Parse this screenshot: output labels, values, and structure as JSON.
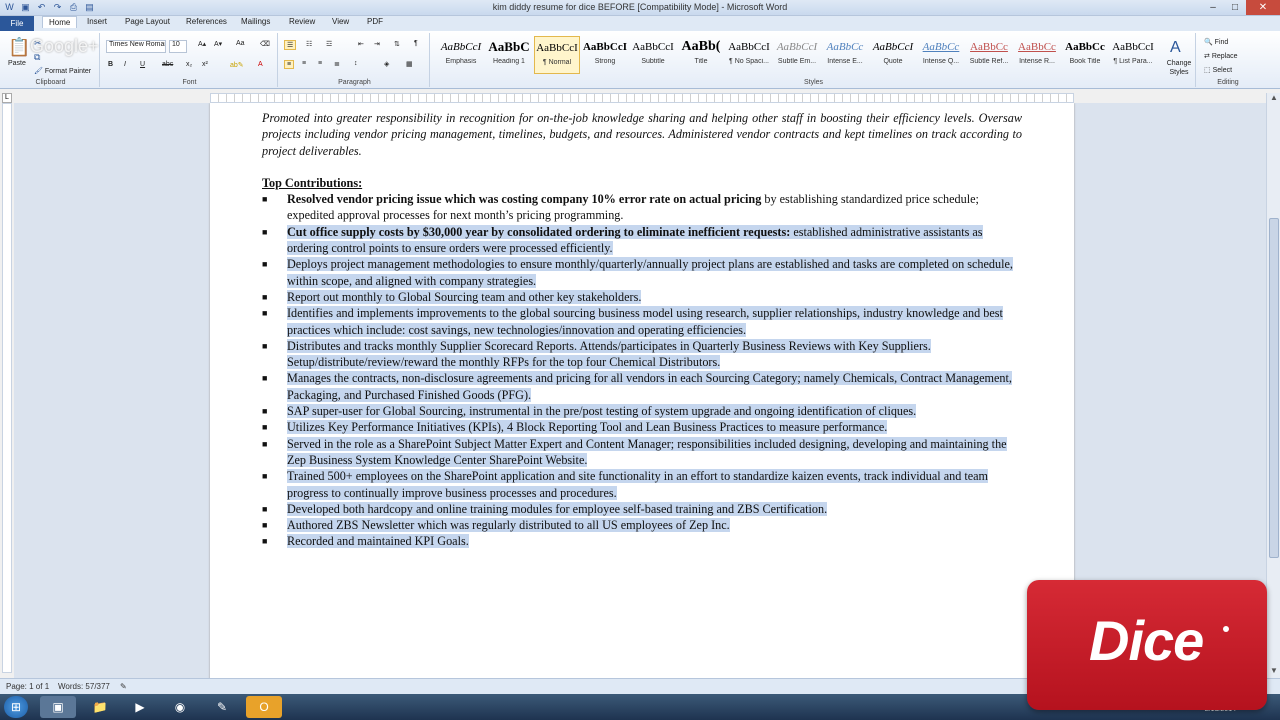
{
  "window": {
    "title": "kim diddy resume for dice  BEFORE [Compatibility Mode] - Microsoft Word"
  },
  "tabs": [
    "File",
    "Home",
    "Insert",
    "Page Layout",
    "References",
    "Mailings",
    "Review",
    "View",
    "PDF"
  ],
  "ribbon": {
    "clipboard": {
      "paste": "Paste",
      "format_painter": "Format Painter",
      "label": "Clipboard"
    },
    "font": {
      "name": "Times New Roman",
      "size": "10",
      "label": "Font"
    },
    "paragraph": {
      "label": "Paragraph"
    },
    "styles": {
      "label": "Styles",
      "change_styles": "Change Styles",
      "items": [
        {
          "sample": "AaBbCcI",
          "name": "Emphasis"
        },
        {
          "sample": "AaBbC",
          "name": "Heading 1"
        },
        {
          "sample": "AaBbCcI",
          "name": "¶ Normal"
        },
        {
          "sample": "AaBbCcI",
          "name": "Strong"
        },
        {
          "sample": "AaBbCcI",
          "name": "Subtitle"
        },
        {
          "sample": "AaBb(",
          "name": "Title"
        },
        {
          "sample": "AaBbCcI",
          "name": "¶ No Spaci..."
        },
        {
          "sample": "AaBbCcI",
          "name": "Subtle Em..."
        },
        {
          "sample": "AaBbCc",
          "name": "Intense E..."
        },
        {
          "sample": "AaBbCcI",
          "name": "Quote"
        },
        {
          "sample": "AaBbCc",
          "name": "Intense Q..."
        },
        {
          "sample": "AaBbCc",
          "name": "Subtle Ref..."
        },
        {
          "sample": "AaBbCc",
          "name": "Intense R..."
        },
        {
          "sample": "AaBbCc",
          "name": "Book Title"
        },
        {
          "sample": "AaBbCcI",
          "name": "¶ List Para..."
        }
      ]
    },
    "editing": {
      "find": "Find",
      "replace": "Replace",
      "select": "Select",
      "label": "Editing"
    }
  },
  "watermark": "Google+",
  "document": {
    "intro": "Promoted into greater responsibility in recognition for on-the-job knowledge sharing and helping other staff in boosting their efficiency levels. Oversaw projects including vendor pricing management, timelines, budgets, and resources. Administered vendor contracts and kept timelines on track according to project deliverables.",
    "heading": "Top Contributions:",
    "bullets": [
      {
        "bold": "Resolved vendor pricing issue which was costing company 10% error rate on actual pricing",
        "text": " by establishing standardized price schedule; expedited approval processes for next month’s pricing programming.",
        "selected": false
      },
      {
        "bold": "Cut office supply costs by $30,000 year by consolidated ordering to eliminate inefficient requests:",
        "text": " established administrative assistants as ordering control points to ensure orders were processed efficiently.",
        "selected": true
      },
      {
        "bold": "",
        "text": "Deploys project management methodologies to ensure monthly/quarterly/annually project plans are established and tasks are completed on schedule, within scope, and aligned with company strategies.",
        "selected": true
      },
      {
        "bold": "",
        "text": "Report out monthly to Global Sourcing team and other key stakeholders.",
        "selected": true
      },
      {
        "bold": "",
        "text": "Identifies and implements improvements to the global sourcing business model using research, supplier relationships, industry knowledge and best practices which include:  cost savings, new technologies/innovation and operating efficiencies.",
        "selected": true
      },
      {
        "bold": "",
        "text": "Distributes and tracks monthly Supplier Scorecard Reports.  Attends/participates in Quarterly Business Reviews with Key Suppliers.  Setup/distribute/review/reward the monthly RFPs for the top four Chemical Distributors.",
        "selected": true
      },
      {
        "bold": "",
        "text": "Manages the contracts, non-disclosure agreements and pricing for all vendors in each Sourcing Category; namely Chemicals, Contract Management, Packaging, and Purchased Finished Goods (PFG).",
        "selected": true
      },
      {
        "bold": "",
        "text": "SAP super-user for Global Sourcing, instrumental in the pre/post testing of system upgrade and ongoing identification of cliques.",
        "selected": true
      },
      {
        "bold": "",
        "text": "Utilizes Key Performance Initiatives (KPIs), 4 Block Reporting Tool and Lean Business Practices to measure performance.",
        "selected": true
      },
      {
        "bold": "",
        "text": "Served in the role as a SharePoint Subject Matter Expert and Content Manager; responsibilities included designing, developing and maintaining the Zep Business System Knowledge Center SharePoint Website.",
        "selected": true
      },
      {
        "bold": "",
        "text": "Trained 500+ employees on the SharePoint application and site functionality in an effort to standardize kaizen events, track individual and team progress to continually improve business processes and procedures.",
        "selected": true
      },
      {
        "bold": "",
        "text": "Developed both hardcopy and online training modules for employee self-based training and ZBS Certification.",
        "selected": true
      },
      {
        "bold": "",
        "text": "Authored ZBS Newsletter which was regularly distributed to all US employees of Zep Inc.",
        "selected": true
      },
      {
        "bold": "",
        "text": "Recorded and maintained KPI Goals.",
        "selected": true
      }
    ]
  },
  "status": {
    "page": "Page: 1 of 1",
    "words": "Words: 57/377"
  },
  "taskbar": {
    "date": "2/13/2014"
  },
  "overlay": {
    "logo": "Dice"
  },
  "colors": {
    "selection": "#c5d6ee",
    "dice_red": "#c8202c",
    "file_tab": "#2b579a"
  }
}
